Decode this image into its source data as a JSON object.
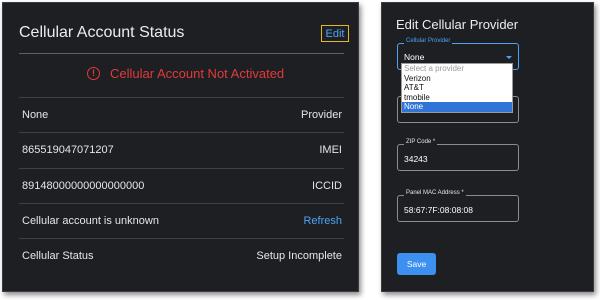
{
  "status_panel": {
    "title": "Cellular Account Status",
    "edit_label": "Edit",
    "alert_text": "Cellular Account Not Activated",
    "rows": [
      {
        "left": "None",
        "right": "Provider"
      },
      {
        "left": "865519047071207",
        "right": "IMEI"
      },
      {
        "left": "89148000000000000000",
        "right": "ICCID"
      },
      {
        "left": "Cellular account is unknown",
        "right": "Refresh"
      },
      {
        "left": "Cellular Status",
        "right": "Setup Incomplete"
      }
    ]
  },
  "provider_panel": {
    "title": "Edit Cellular Provider",
    "provider_field": {
      "label": "Cellular Provider",
      "value": "None"
    },
    "dropdown_options": [
      "Select a provider",
      "Verizon",
      "AT&T",
      "tmobile",
      "None"
    ],
    "zip_field": {
      "label": "ZIP Code *",
      "value": "34243"
    },
    "mac_field": {
      "label": "Panel MAC Address *",
      "value": "58:67:7F:08:08:08"
    },
    "save_label": "Save"
  },
  "colors": {
    "panel_bg": "#1d1f22",
    "alert": "#e23a3a",
    "link": "#4ea3f7",
    "edit_border": "#e3b72a",
    "primary_button": "#3d8ff0",
    "dropdown_selected": "#2f74d6"
  },
  "icons": {
    "alert": "alert-circle-icon",
    "caret": "caret-down-icon"
  }
}
